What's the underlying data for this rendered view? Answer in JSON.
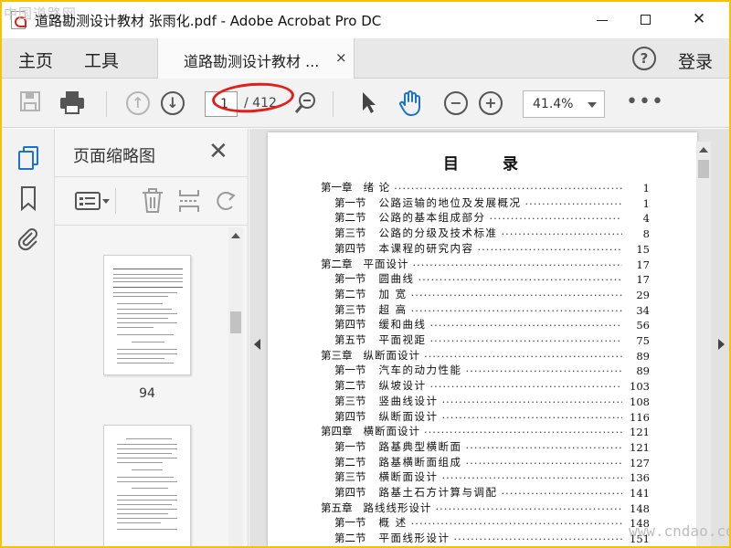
{
  "watermark": "中国道路网",
  "window": {
    "title": "道路勘测设计教材 张雨化.pdf - Adobe Acrobat Pro DC",
    "minimize": "—",
    "maximize": "☐",
    "close": "✕"
  },
  "menubar": {
    "home": "主页",
    "tools": "工具",
    "doc_tab": "道路勘测设计教材 ...",
    "doc_tab_close": "×",
    "help": "?",
    "login": "登录"
  },
  "toolbar": {
    "page_current": "1",
    "page_total": "/ 412",
    "zoom": "41.4%",
    "more": "•••",
    "icons": [
      "save-icon",
      "print-icon",
      "prev-page-icon",
      "next-page-icon",
      "page-zoom-icon",
      "select-arrow-icon",
      "hand-icon",
      "zoom-out-icon",
      "zoom-in-icon"
    ]
  },
  "annotation": {
    "color": "#e0201a"
  },
  "sidebar": {
    "icons": [
      "page-thumbnails-icon",
      "bookmark-icon",
      "attachment-icon"
    ],
    "accent": "#1a73c8"
  },
  "thumbnails_panel": {
    "title": "页面缩略图",
    "close": "✕",
    "thumbnails": [
      {
        "page_label": "94"
      },
      {
        "page_label": ""
      }
    ]
  },
  "document": {
    "heading_left": "目",
    "heading_right": "录",
    "toc": [
      {
        "label": "第一章",
        "title": "绪 论",
        "page": "1",
        "level": "chapter"
      },
      {
        "label": "第一节",
        "title": "公路运输的地位及发展概况",
        "page": "1",
        "level": "section"
      },
      {
        "label": "第二节",
        "title": "公路的基本组成部分",
        "page": "4",
        "level": "section"
      },
      {
        "label": "第三节",
        "title": "公路的分级及技术标准",
        "page": "8",
        "level": "section"
      },
      {
        "label": "第四节",
        "title": "本课程的研究内容",
        "page": "15",
        "level": "section"
      },
      {
        "label": "第二章",
        "title": "平面设计",
        "page": "17",
        "level": "chapter"
      },
      {
        "label": "第一节",
        "title": "圆曲线",
        "page": "17",
        "level": "section"
      },
      {
        "label": "第二节",
        "title": "加 宽",
        "page": "29",
        "level": "section"
      },
      {
        "label": "第三节",
        "title": "超 高",
        "page": "34",
        "level": "section"
      },
      {
        "label": "第四节",
        "title": "缓和曲线",
        "page": "56",
        "level": "section"
      },
      {
        "label": "第五节",
        "title": "平面视距",
        "page": "75",
        "level": "section"
      },
      {
        "label": "第三章",
        "title": "纵断面设计",
        "page": "89",
        "level": "chapter"
      },
      {
        "label": "第一节",
        "title": "汽车的动力性能",
        "page": "89",
        "level": "section"
      },
      {
        "label": "第二节",
        "title": "纵坡设计",
        "page": "103",
        "level": "section"
      },
      {
        "label": "第三节",
        "title": "竖曲线设计",
        "page": "108",
        "level": "section"
      },
      {
        "label": "第四节",
        "title": "纵断面设计",
        "page": "116",
        "level": "section"
      },
      {
        "label": "第四章",
        "title": "横断面设计",
        "page": "121",
        "level": "chapter"
      },
      {
        "label": "第一节",
        "title": "路基典型横断面",
        "page": "121",
        "level": "section"
      },
      {
        "label": "第二节",
        "title": "路基横断面组成",
        "page": "127",
        "level": "section"
      },
      {
        "label": "第三节",
        "title": "横断面设计",
        "page": "136",
        "level": "section"
      },
      {
        "label": "第四节",
        "title": "路基土石方计算与调配",
        "page": "141",
        "level": "section"
      },
      {
        "label": "第五章",
        "title": "路线线形设计",
        "page": "148",
        "level": "chapter"
      },
      {
        "label": "第一节",
        "title": "概 述",
        "page": "148",
        "level": "section"
      },
      {
        "label": "第二节",
        "title": "平面线形设计",
        "page": "151",
        "level": "section"
      }
    ]
  },
  "site_watermark": "www.cndao.com"
}
